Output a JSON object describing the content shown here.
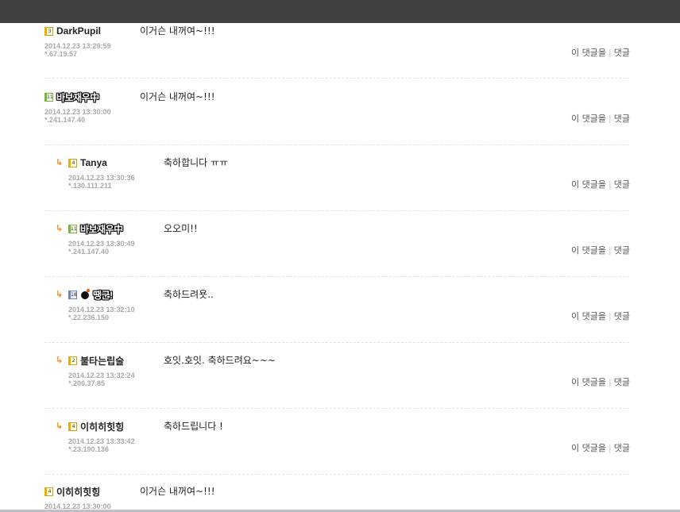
{
  "comments": [
    {
      "kind": "main",
      "level": "3",
      "level_color": "yellow",
      "nick": "DarkPupil",
      "nick_style": "text",
      "date": "2014.12.23 13:29:59",
      "ip": "*.67.19.57",
      "text": "이거슨 내꺼여~!!!",
      "reply_label": "이 댓글을",
      "reply_label2": "댓글"
    },
    {
      "kind": "main",
      "level": "11",
      "level_color": "green",
      "nick": "바보재우中",
      "nick_style": "image",
      "date": "2014.12.23 13:30:00",
      "ip": "*.241.147.40",
      "text": "이거슨 내꺼여~!!!",
      "reply_label": "이 댓글을",
      "reply_label2": "댓글"
    },
    {
      "kind": "reply",
      "level": "4",
      "level_color": "yellow",
      "nick": "Tanya",
      "nick_style": "text",
      "date": "2014.12.23 13:30:36",
      "ip": "*.130.111.211",
      "text": "축하합니다 ㅠㅠ",
      "reply_label": "이 댓글을",
      "reply_label2": "댓글"
    },
    {
      "kind": "reply",
      "level": "11",
      "level_color": "green",
      "nick": "바보재우中",
      "nick_style": "image",
      "date": "2014.12.23 13:30:49",
      "ip": "*.241.147.40",
      "text": "오오미!!",
      "reply_label": "이 댓글을",
      "reply_label2": "댓글"
    },
    {
      "kind": "reply",
      "level": "18",
      "level_color": "blue",
      "nick": "땡군!",
      "nick_style": "image-bomb",
      "date": "2014.12.23 13:32:10",
      "ip": "*.22.236.150",
      "text": "축하드려욧..",
      "reply_label": "이 댓글을",
      "reply_label2": "댓글"
    },
    {
      "kind": "reply",
      "level": "2",
      "level_color": "yellow",
      "nick": "불타는립술",
      "nick_style": "text",
      "date": "2014.12.23 13:32:24",
      "ip": "*.200.37.85",
      "text": "호잇.호잇. 축하드려요~~~",
      "reply_label": "이 댓글을",
      "reply_label2": "댓글"
    },
    {
      "kind": "reply",
      "level": "4",
      "level_color": "yellow",
      "nick": "이히히힛힝",
      "nick_style": "text",
      "date": "2014.12.23 13:33:42",
      "ip": "*.23.190.136",
      "text": "축하드립니다 !",
      "reply_label": "이 댓글을",
      "reply_label2": "댓글"
    },
    {
      "kind": "main",
      "level": "4",
      "level_color": "yellow",
      "nick": "이히히힛힝",
      "nick_style": "text",
      "date": "2014.12.23 13:30:00",
      "ip": "",
      "text": "이거슨 내꺼여~!!!",
      "reply_label": "",
      "reply_label2": ""
    }
  ]
}
